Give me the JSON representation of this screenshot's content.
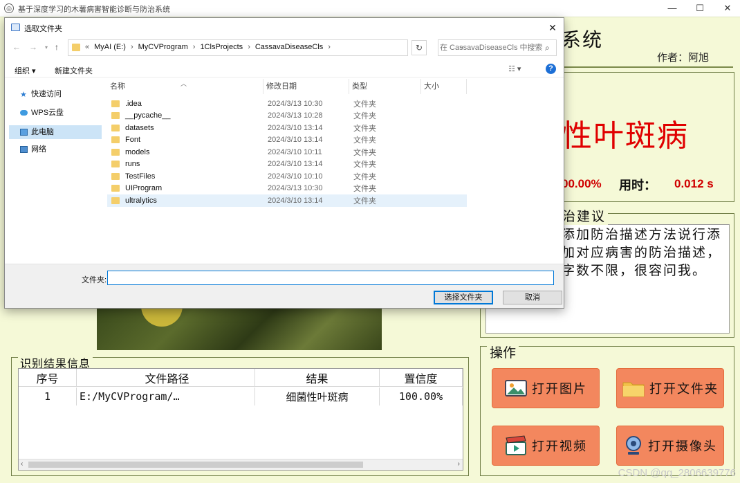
{
  "app": {
    "title": "基于深度学习的木薯病害智能诊断与防治系统",
    "header_fragment": "系统",
    "author": "作者：阿旭",
    "result_name": "性叶斑病",
    "confidence_value": "00.00%",
    "time_label": "用时：",
    "time_value": "0.012 s",
    "advice_title": "治建议",
    "advice_text": "添加防治描述方法说行添加对应病害的防治描述，字数不限，很容问我。",
    "ops_title": "操作",
    "buttons": {
      "open_image": "打开图片",
      "open_folder": "打开文件夹",
      "open_video": "打开视频",
      "open_camera": "打开摄像头"
    },
    "table_title": "识别结果信息",
    "table": {
      "headers": [
        "序号",
        "文件路径",
        "结果",
        "置信度"
      ],
      "rows": [
        [
          "1",
          "E:/MyCVProgram/…",
          "细菌性叶斑病",
          "100.00%"
        ]
      ]
    },
    "watermark": "CSDN @qq_2806639776"
  },
  "dialog": {
    "title": "选取文件夹",
    "close": "✕",
    "path": [
      "MyAI (E:)",
      "MyCVProgram",
      "1ClsProjects",
      "CassavaDiseaseCls"
    ],
    "search_placeholder": "在 CassavaDiseaseCls 中搜索",
    "organize": "组织 ▾",
    "new_folder": "新建文件夹",
    "nav": [
      {
        "label": "快速访问",
        "icon": "star-icon"
      },
      {
        "label": "WPS云盘",
        "icon": "cloud-icon"
      },
      {
        "label": "此电脑",
        "icon": "computer-icon",
        "selected": true
      },
      {
        "label": "网络",
        "icon": "network-icon"
      }
    ],
    "columns": [
      "名称",
      "修改日期",
      "类型",
      "大小"
    ],
    "files": [
      {
        "name": ".idea",
        "date": "2024/3/13 10:30",
        "type": "文件夹"
      },
      {
        "name": "__pycache__",
        "date": "2024/3/13 10:28",
        "type": "文件夹"
      },
      {
        "name": "datasets",
        "date": "2024/3/10 13:14",
        "type": "文件夹"
      },
      {
        "name": "Font",
        "date": "2024/3/10 13:14",
        "type": "文件夹"
      },
      {
        "name": "models",
        "date": "2024/3/10 10:11",
        "type": "文件夹"
      },
      {
        "name": "runs",
        "date": "2024/3/10 13:14",
        "type": "文件夹"
      },
      {
        "name": "TestFiles",
        "date": "2024/3/10 10:10",
        "type": "文件夹"
      },
      {
        "name": "UIProgram",
        "date": "2024/3/13 10:30",
        "type": "文件夹"
      },
      {
        "name": "ultralytics",
        "date": "2024/3/10 13:14",
        "type": "文件夹"
      }
    ],
    "folder_label": "文件夹:",
    "folder_value": "",
    "select_button": "选择文件夹",
    "cancel_button": "取消"
  }
}
